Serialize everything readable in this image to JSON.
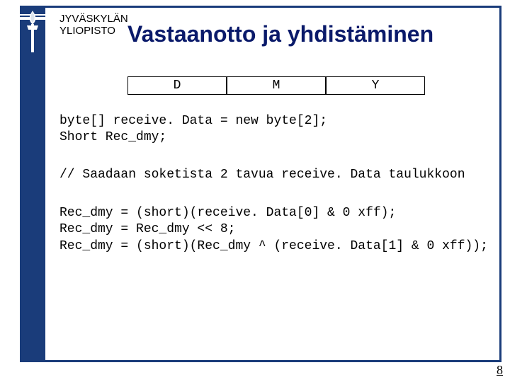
{
  "institution": {
    "line1": "JYVÄSKYLÄN",
    "line2": "YLIOPISTO"
  },
  "title": "Vastaanotto ja yhdistäminen",
  "table": {
    "cells": [
      "D",
      "M",
      "Y"
    ]
  },
  "code_block1": "byte[] receive. Data = new byte[2];\nShort Rec_dmy;",
  "code_block2": "// Saadaan soketista 2 tavua receive. Data taulukkoon",
  "code_block3": "Rec_dmy = (short)(receive. Data[0] & 0 xff);\nRec_dmy = Rec_dmy << 8;\nRec_dmy = (short)(Rec_dmy ^ (receive. Data[1] & 0 xff));",
  "page_number": "8"
}
